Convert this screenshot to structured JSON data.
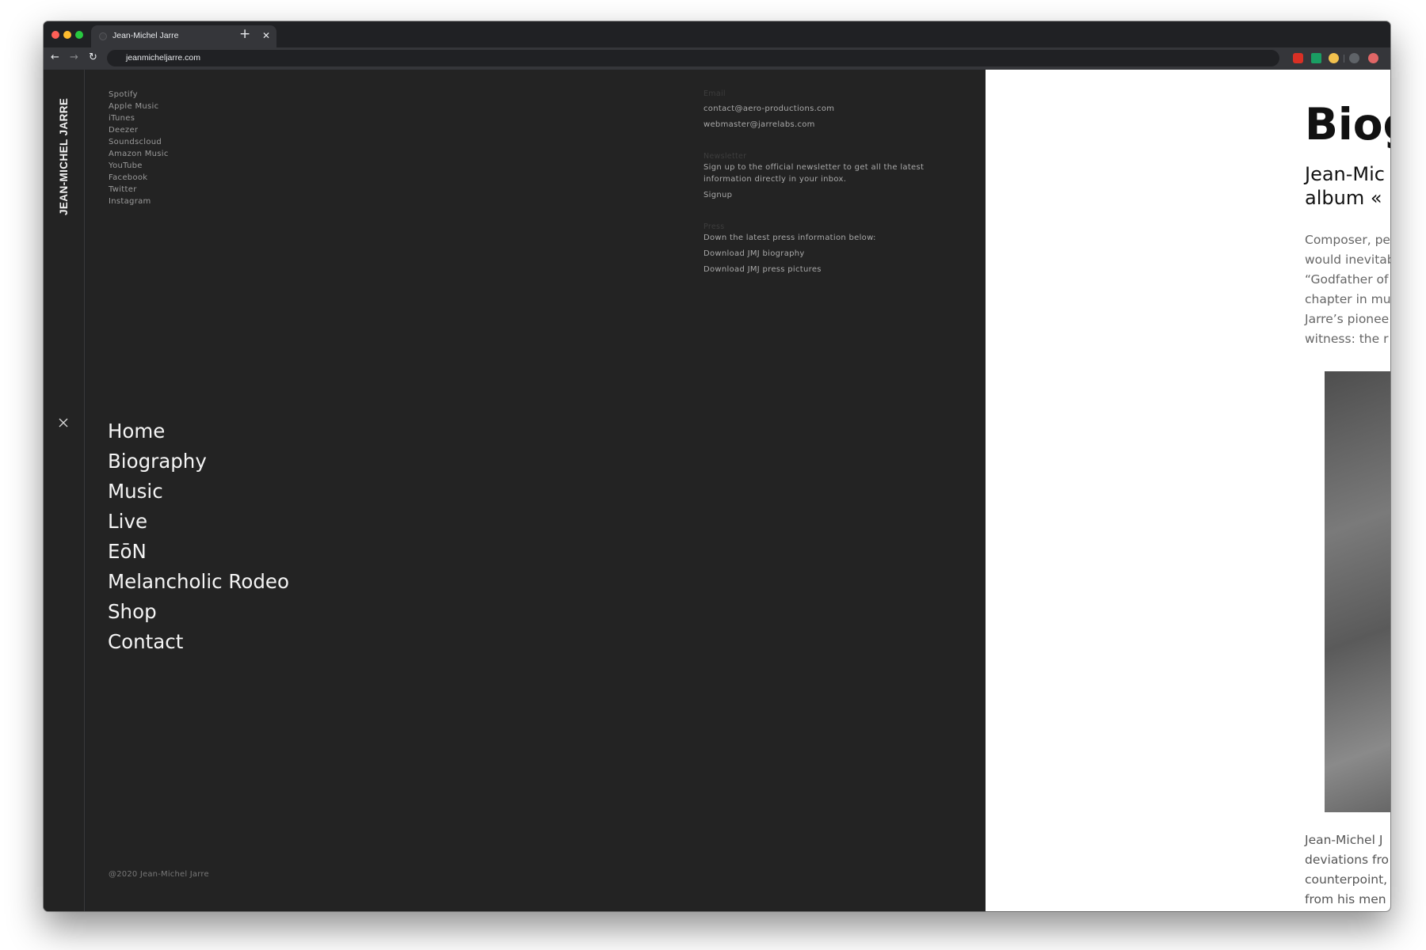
{
  "browser": {
    "tab_title": "Jean-Michel Jarre",
    "tab_close": "✕",
    "new_tab": "+",
    "url": "jeanmicheljarre.com",
    "back": "←",
    "forward": "→",
    "reload": "↻",
    "extensions": [
      "adblock-icon",
      "leaf-extension-icon",
      "compass-extension-icon",
      "profile-extension-icon",
      "record-extension-icon"
    ]
  },
  "sidebar": {
    "brand": "JEAN-MICHEL JARRE"
  },
  "social_links": [
    "Spotify",
    "Apple Music",
    "iTunes",
    "Deezer",
    "Soundscloud",
    "Amazon Music",
    "YouTube",
    "Facebook",
    "Twitter",
    "Instagram"
  ],
  "main_nav": [
    "Home",
    "Biography",
    "Music",
    "Live",
    "EōN",
    "Melancholic Rodeo",
    "Shop",
    "Contact"
  ],
  "contact": {
    "email_label": "Email",
    "emails": [
      "contact@aero-productions.com",
      "webmaster@jarrelabs.com"
    ],
    "newsletter_label": "Newsletter",
    "newsletter_text": "Sign up to the official newsletter to get all the latest information directly in your inbox.",
    "newsletter_link": "Signup",
    "press_label": "Press",
    "press_text": "Down the latest press information below:",
    "press_links": [
      "Download JMJ biography",
      "Download JMJ press pictures"
    ]
  },
  "footer": {
    "copyright": "@2020 Jean-Michel Jarre"
  },
  "content": {
    "heading": "Biog",
    "subheading_lines": [
      "Jean-Mic",
      "album «"
    ],
    "intro_lines": [
      "Composer, pe",
      "would inevitab",
      "“Godfather of",
      "chapter in mu",
      "Jarre’s pionee",
      "witness: the r"
    ],
    "bottom_lines": [
      "Jean-Michel J",
      "deviations fro",
      "counterpoint,",
      "from his men"
    ]
  },
  "colors": {
    "menu_bg": "#232323",
    "page_bg": "#ffffff",
    "chrome_bg": "#202124",
    "toolbar_bg": "#35363a"
  }
}
